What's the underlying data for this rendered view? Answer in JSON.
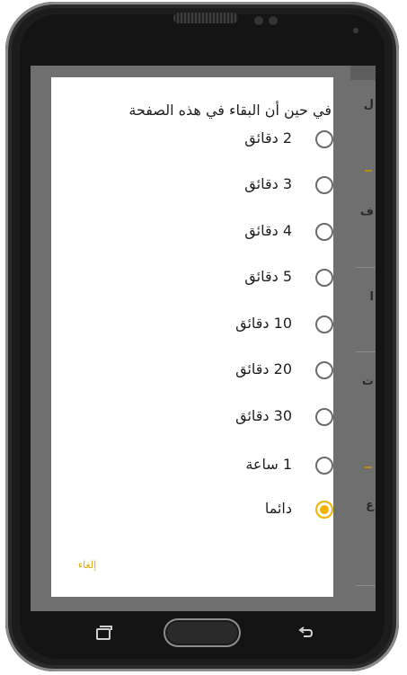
{
  "dialog": {
    "title": "في حين أن البقاء في هذه الصفحة",
    "options": [
      {
        "label": "2 دقائق",
        "selected": false
      },
      {
        "label": "3 دقائق",
        "selected": false
      },
      {
        "label": "4 دقائق",
        "selected": false
      },
      {
        "label": "5 دقائق",
        "selected": false
      },
      {
        "label": "10 دقائق",
        "selected": false
      },
      {
        "label": "20 دقائق",
        "selected": false
      },
      {
        "label": "30 دقائق",
        "selected": false
      },
      {
        "label": "1 ساعة",
        "selected": false
      },
      {
        "label": "دائما",
        "selected": true
      }
    ],
    "cancel_label": "إلغاء"
  },
  "background": {
    "chars": [
      "ل",
      "ف",
      "ا",
      "ت",
      "ع"
    ]
  },
  "colors": {
    "accent": "#f0b400",
    "radio_unchecked": "#6b6b6b",
    "scrim": "#6f6f6f"
  },
  "icons": {
    "nav_recent": "recent-apps-icon",
    "nav_home": "home-button",
    "nav_back": "back-icon"
  }
}
